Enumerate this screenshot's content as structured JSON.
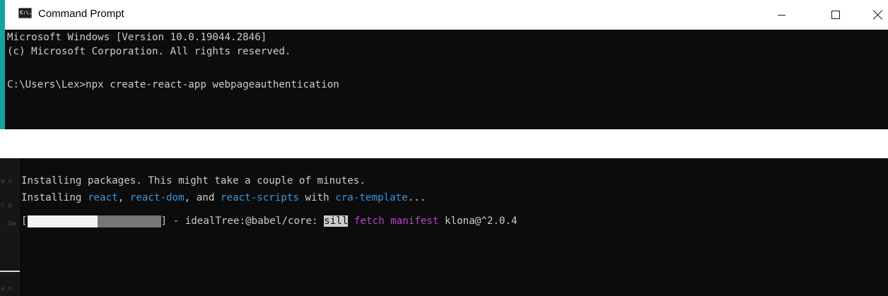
{
  "window": {
    "title": "Command Prompt",
    "icon_label": "C:\\.",
    "controls": [
      "minimize-icon",
      "maximize-icon",
      "close-icon"
    ]
  },
  "console_top": {
    "lines": [
      "Microsoft Windows [Version 10.0.19044.2846]",
      "(c) Microsoft Corporation. All rights reserved.",
      "C:\\Users\\Lex>npx create-react-app webpageauthentication"
    ]
  },
  "console_bottom": {
    "line1": "Installing packages. This might take a couple of minutes.",
    "line2": {
      "prefix": "Installing ",
      "pkg1": "react",
      "sep1": ", ",
      "pkg2": "react-dom",
      "sep2": ", and ",
      "pkg3": "react-scripts",
      "mid": " with ",
      "pkg4": "cra-template",
      "suffix": "..."
    },
    "progress": {
      "open": "[",
      "close": "]",
      "fraction_white": 0.52,
      "text": " - idealTree:@babel/core: ",
      "level": "sill",
      "action": "fetch manifest",
      "target": " klona@^2.0.4"
    }
  },
  "colors": {
    "accent": "#12a3a3",
    "console_bg": "#0c0c0c",
    "text": "#cccccc",
    "blue": "#3a96dd",
    "magenta": "#b148c6"
  }
}
